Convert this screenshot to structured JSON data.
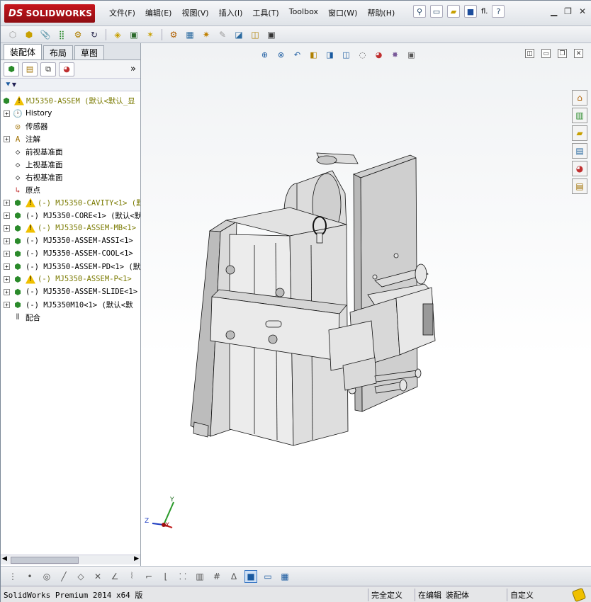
{
  "app": {
    "brand_prefix": "DS",
    "brand": "SOLIDWORKS"
  },
  "menu": [
    "文件(F)",
    "编辑(E)",
    "视图(V)",
    "插入(I)",
    "工具(T)",
    "Toolbox",
    "窗口(W)",
    "帮助(H)"
  ],
  "quick_access": {
    "icons": [
      "new-icon",
      "open-icon",
      "save-icon",
      "print-icon",
      "help-icon"
    ],
    "misc_label": "fl."
  },
  "window_controls": [
    "minimize-icon",
    "restore-icon",
    "close-icon"
  ],
  "left_panel": {
    "tabs": [
      "装配体",
      "布局",
      "草图"
    ],
    "active_tab": 0,
    "panel_tools": [
      "featuremanager-icon",
      "propertymanager-icon",
      "configurationmanager-icon",
      "displaymanager-icon"
    ],
    "more_symbol": "»",
    "filter_symbol": "▼"
  },
  "tree": {
    "root": "MJ5350-ASSEM  (默认<默认_显",
    "items": [
      {
        "label": "History",
        "icon": "history-icon",
        "expandable": true,
        "warning": false,
        "olive": false
      },
      {
        "label": "传感器",
        "icon": "sensor-icon",
        "expandable": false,
        "warning": false,
        "olive": false
      },
      {
        "label": "注解",
        "icon": "annotation-icon",
        "expandable": true,
        "warning": false,
        "olive": false
      },
      {
        "label": "前视基准面",
        "icon": "plane-icon",
        "expandable": false,
        "warning": false,
        "olive": false
      },
      {
        "label": "上视基准面",
        "icon": "plane-icon",
        "expandable": false,
        "warning": false,
        "olive": false
      },
      {
        "label": "右视基准面",
        "icon": "plane-icon",
        "expandable": false,
        "warning": false,
        "olive": false
      },
      {
        "label": "原点",
        "icon": "origin-icon",
        "expandable": false,
        "warning": false,
        "olive": false
      },
      {
        "label": "(-) MJ5350-CAVITY<1> (默",
        "icon": "assembly-icon",
        "expandable": true,
        "warning": true,
        "olive": true
      },
      {
        "label": "(-) MJ5350-CORE<1> (默认<默",
        "icon": "assembly-icon",
        "expandable": true,
        "warning": false,
        "olive": false
      },
      {
        "label": "(-) MJ5350-ASSEM-MB<1>",
        "icon": "assembly-icon",
        "expandable": true,
        "warning": true,
        "olive": true
      },
      {
        "label": "(-) MJ5350-ASSEM-ASSI<1>",
        "icon": "assembly-icon",
        "expandable": true,
        "warning": false,
        "olive": false
      },
      {
        "label": "(-) MJ5350-ASSEM-COOL<1>",
        "icon": "assembly-icon",
        "expandable": true,
        "warning": false,
        "olive": false
      },
      {
        "label": "(-) MJ5350-ASSEM-PD<1> (默",
        "icon": "assembly-icon",
        "expandable": true,
        "warning": false,
        "olive": false
      },
      {
        "label": "(-) MJ5350-ASSEM-P<1>",
        "icon": "assembly-icon",
        "expandable": true,
        "warning": true,
        "olive": true
      },
      {
        "label": "(-) MJ5350-ASSEM-SLIDE<1>",
        "icon": "assembly-icon",
        "expandable": true,
        "warning": false,
        "olive": false
      },
      {
        "label": "(-) MJ5350M10<1> (默认<默",
        "icon": "assembly-icon",
        "expandable": true,
        "warning": false,
        "olive": false
      },
      {
        "label": "配合",
        "icon": "mates-icon",
        "expandable": false,
        "warning": false,
        "olive": false
      }
    ]
  },
  "viewport": {
    "headsup_icons": [
      "zoom-to-fit-icon",
      "zoom-area-icon",
      "previous-view-icon",
      "section-view-icon",
      "view-orientation-icon",
      "display-style-icon",
      "hide-show-icon",
      "appearance-icon",
      "scene-icon",
      "view-settings-icon"
    ],
    "task_pane": [
      "home-icon",
      "design-library-icon",
      "file-explorer-icon",
      "view-palette-icon",
      "appearances-icon",
      "custom-properties-icon"
    ],
    "triad": {
      "x": "X",
      "y": "Y",
      "z": "Z"
    }
  },
  "bottom_toolbar": [
    "point-icon",
    "circle-icon",
    "line-icon",
    "polygon-icon",
    "trim-icon",
    "extend-icon",
    "mirror-icon",
    "fillet-icon",
    "chamfer-icon",
    "dimension-icon",
    "grid-icon",
    "relation-icon",
    "shaded-icon",
    "rectangle-icon",
    "table-icon"
  ],
  "status": {
    "product": "SolidWorks Premium 2014 x64 版",
    "state": "完全定义",
    "editing_prefix": "在编辑",
    "editing": "装配体",
    "custom": "自定义"
  }
}
